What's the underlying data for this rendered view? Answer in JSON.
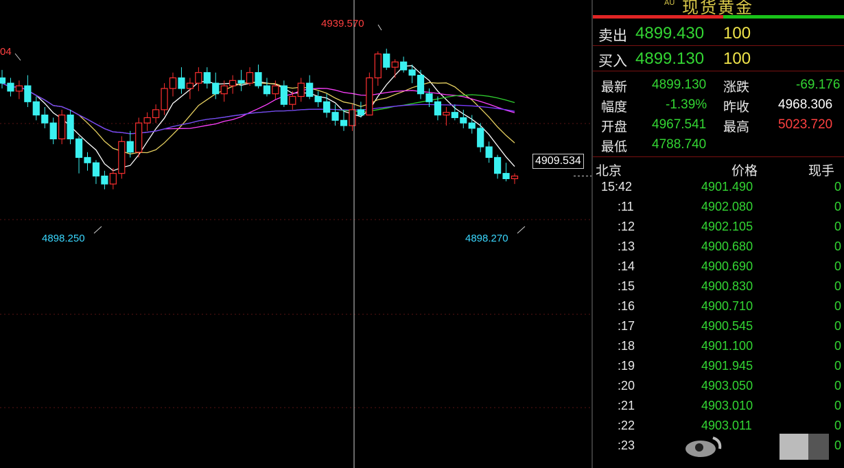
{
  "panel": {
    "tag": "AU",
    "title": "现货黄金",
    "sell_label": "卖出",
    "sell_price": "4899.430",
    "sell_vol": "100",
    "buy_label": "买入",
    "buy_price": "4899.130",
    "buy_vol": "100",
    "stats": {
      "latest_label": "最新",
      "latest": "4899.130",
      "change_label": "涨跌",
      "change": "-69.176",
      "pct_label": "幅度",
      "pct": "-1.39%",
      "prev_label": "昨收",
      "prev": "4968.306",
      "open_label": "开盘",
      "open": "4967.541",
      "high_label": "最高",
      "high": "5023.720",
      "low_label": "最低",
      "low": "4788.740"
    },
    "ticks_header": {
      "time": "北京",
      "price": "价格",
      "vol": "现手"
    },
    "ticks": [
      {
        "time": "15:42",
        "price": "4901.490",
        "vol": "0"
      },
      {
        "time": ":11",
        "price": "4902.080",
        "vol": "0"
      },
      {
        "time": ":12",
        "price": "4902.105",
        "vol": "0"
      },
      {
        "time": ":13",
        "price": "4900.680",
        "vol": "0"
      },
      {
        "time": ":14",
        "price": "4900.690",
        "vol": "0"
      },
      {
        "time": ":15",
        "price": "4900.830",
        "vol": "0"
      },
      {
        "time": ":16",
        "price": "4900.710",
        "vol": "0"
      },
      {
        "time": ":17",
        "price": "4900.545",
        "vol": "0"
      },
      {
        "time": ":18",
        "price": "4901.100",
        "vol": "0"
      },
      {
        "time": ":19",
        "price": "4901.945",
        "vol": "0"
      },
      {
        "time": ":20",
        "price": "4903.050",
        "vol": "0"
      },
      {
        "time": ":21",
        "price": "4903.010",
        "vol": "0"
      },
      {
        "time": ":22",
        "price": "4903.011",
        "vol": "0"
      },
      {
        "time": ":23",
        "price": "",
        "vol": "0"
      }
    ]
  },
  "chart_data": {
    "type": "candlestick",
    "ylim": [
      4880,
      4955
    ],
    "annotations": {
      "high": "4939.570",
      "low_left": "4898.250",
      "low_right": "4898.270",
      "left_cut": "04",
      "crosshair_price": "4909.534"
    },
    "colors": {
      "up": "#ff3030",
      "down": "#3af0f0",
      "ma5": "#ffffff",
      "ma10": "#e6d060",
      "ma20": "#ff40ff",
      "ma60": "#30d030",
      "ma120": "#7a3cff"
    },
    "candles": [
      [
        4936,
        4939,
        4932,
        4934
      ],
      [
        4934,
        4936,
        4929,
        4931
      ],
      [
        4931,
        4935,
        4928,
        4933
      ],
      [
        4933,
        4937,
        4925,
        4927
      ],
      [
        4927,
        4929,
        4920,
        4922
      ],
      [
        4922,
        4925,
        4917,
        4919
      ],
      [
        4919,
        4921,
        4911,
        4913
      ],
      [
        4913,
        4924,
        4911,
        4922
      ],
      [
        4922,
        4924,
        4911,
        4913
      ],
      [
        4913,
        4914,
        4900,
        4906
      ],
      [
        4906,
        4908,
        4901,
        4904
      ],
      [
        4904,
        4905,
        4896,
        4899
      ],
      [
        4899,
        4901,
        4894,
        4896
      ],
      [
        4896,
        4902,
        4894,
        4900
      ],
      [
        4900,
        4914,
        4898,
        4912
      ],
      [
        4912,
        4916,
        4906,
        4908
      ],
      [
        4908,
        4921,
        4906,
        4919
      ],
      [
        4919,
        4923,
        4916,
        4921
      ],
      [
        4921,
        4926,
        4919,
        4924
      ],
      [
        4924,
        4934,
        4922,
        4932
      ],
      [
        4932,
        4938,
        4929,
        4936
      ],
      [
        4936,
        4940,
        4930,
        4932
      ],
      [
        4932,
        4936,
        4928,
        4934
      ],
      [
        4934,
        4940,
        4931,
        4938
      ],
      [
        4938,
        4940,
        4932,
        4934
      ],
      [
        4934,
        4938,
        4928,
        4930
      ],
      [
        4930,
        4935,
        4927,
        4933
      ],
      [
        4933,
        4937,
        4930,
        4935
      ],
      [
        4935,
        4939,
        4931,
        4934
      ],
      [
        4934,
        4940,
        4933,
        4938
      ],
      [
        4938,
        4941,
        4932,
        4933
      ],
      [
        4933,
        4936,
        4929,
        4930
      ],
      [
        4930,
        4935,
        4928,
        4933
      ],
      [
        4933,
        4935,
        4925,
        4926
      ],
      [
        4926,
        4931,
        4924,
        4929
      ],
      [
        4929,
        4936,
        4927,
        4934
      ],
      [
        4934,
        4937,
        4928,
        4929
      ],
      [
        4929,
        4931,
        4925,
        4927
      ],
      [
        4927,
        4930,
        4921,
        4923
      ],
      [
        4923,
        4926,
        4918,
        4920
      ],
      [
        4920,
        4924,
        4916,
        4918
      ],
      [
        4918,
        4926,
        4916,
        4924
      ],
      [
        4924,
        4927,
        4921,
        4922
      ],
      [
        4922,
        4938,
        4922,
        4936
      ],
      [
        4936,
        4946,
        4933,
        4945
      ],
      [
        4945,
        4947,
        4939,
        4940
      ],
      [
        4940,
        4943,
        4936,
        4942
      ],
      [
        4942,
        4944,
        4938,
        4939
      ],
      [
        4939,
        4941,
        4934,
        4937
      ],
      [
        4937,
        4939,
        4928,
        4930
      ],
      [
        4930,
        4932,
        4925,
        4927
      ],
      [
        4927,
        4929,
        4920,
        4922
      ],
      [
        4922,
        4925,
        4918,
        4923
      ],
      [
        4923,
        4926,
        4920,
        4921
      ],
      [
        4921,
        4924,
        4917,
        4919
      ],
      [
        4919,
        4922,
        4915,
        4917
      ],
      [
        4917,
        4919,
        4908,
        4910
      ],
      [
        4910,
        4912,
        4904,
        4906
      ],
      [
        4906,
        4907,
        4898,
        4900
      ],
      [
        4900,
        4904,
        4897,
        4898
      ],
      [
        4898,
        4900,
        4896,
        4899
      ]
    ]
  }
}
